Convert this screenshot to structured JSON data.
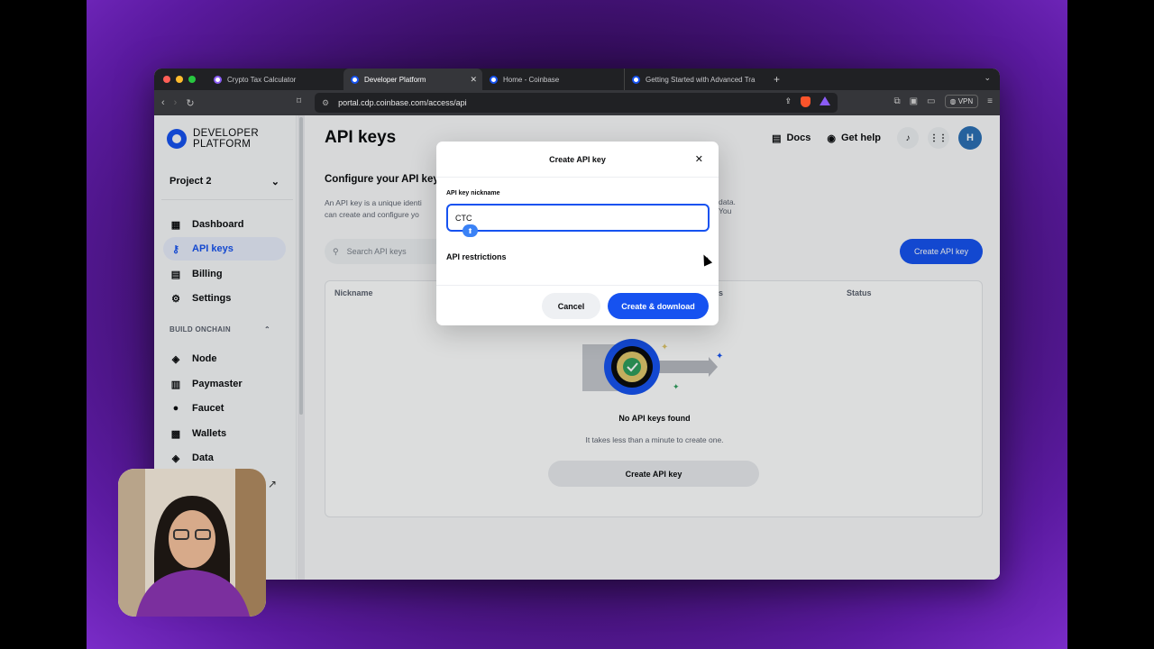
{
  "tabs": [
    {
      "label": "Crypto Tax Calculator",
      "active": false
    },
    {
      "label": "Developer Platform",
      "active": true
    },
    {
      "label": "Home - Coinbase",
      "active": false
    },
    {
      "label": "Getting Started with Advanced Tra",
      "active": false
    }
  ],
  "toolbar": {
    "url": "portal.cdp.coinbase.com/access/api",
    "vpn_label": "VPN"
  },
  "sidebar": {
    "logo_line1": "DEVELOPER",
    "logo_line2": "PLATFORM",
    "project": "Project 2",
    "items": [
      {
        "label": "Dashboard",
        "icon": "dashboard-icon"
      },
      {
        "label": "API keys",
        "icon": "key-icon",
        "active": true
      },
      {
        "label": "Billing",
        "icon": "billing-icon"
      },
      {
        "label": "Settings",
        "icon": "gear-icon"
      }
    ],
    "section": "BUILD ONCHAIN",
    "build_items": [
      {
        "label": "Node",
        "icon": "layers-icon"
      },
      {
        "label": "Paymaster",
        "icon": "receipt-icon"
      },
      {
        "label": "Faucet",
        "icon": "drop-icon"
      },
      {
        "label": "Wallets",
        "icon": "wallet-icon"
      },
      {
        "label": "Data",
        "icon": "layers-icon"
      }
    ]
  },
  "header": {
    "title": "API keys",
    "docs": "Docs",
    "help": "Get help",
    "avatar": "H"
  },
  "content": {
    "config_title": "Configure your API key",
    "config_desc_line1": "An API key is a unique identi",
    "config_desc_line2": "can create and configure yo",
    "config_desc_tail": "data. You",
    "search_placeholder": "Search API keys",
    "create_button": "Create API key"
  },
  "table": {
    "columns": [
      "Nickname",
      "s",
      "Status"
    ],
    "empty_title": "No API keys found",
    "empty_sub": "It takes less than a minute to create one.",
    "empty_button": "Create API key"
  },
  "modal": {
    "title": "Create API key",
    "field_label": "API key nickname",
    "field_value": "CTC",
    "restrictions": "API restrictions",
    "cancel": "Cancel",
    "create": "Create & download"
  },
  "colors": {
    "brand": "#1652f0",
    "accent_bg": "#e8edfb"
  }
}
